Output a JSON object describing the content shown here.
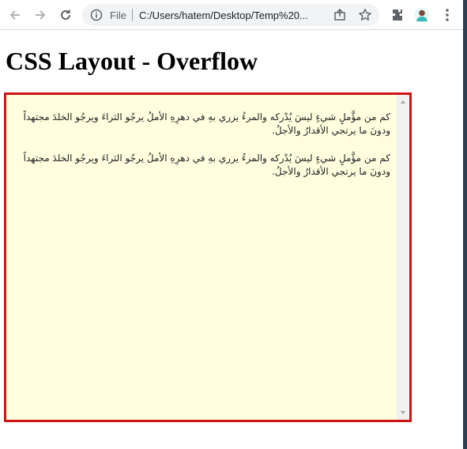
{
  "browser": {
    "scheme_label": "File",
    "url": "C:/Users/hatem/Desktop/Temp%20..."
  },
  "page": {
    "title": "CSS Layout - Overflow",
    "paragraphs": [
      "كم من مؤَّملٍ شيءٍ ليسَ يُدْركه والمرءُ يزري بهِ في دهرِهِ الأملُ يرجُو الثراءَ ويرجُو الخلدَ مجتهداً ودونَ ما يرتجي الأقدارُ والأجلُ.",
      "كم من مؤَّملٍ شيءٍ ليسَ يُدْركه والمرءُ يزري بهِ في دهرِهِ الأملُ يرجُو الثراءَ ويرجُو الخلدَ مجتهداً ودونَ ما يرتجي الأقدارُ والأجلُ."
    ]
  },
  "colors": {
    "box_border": "#d01212",
    "box_background": "#ffffe0"
  }
}
